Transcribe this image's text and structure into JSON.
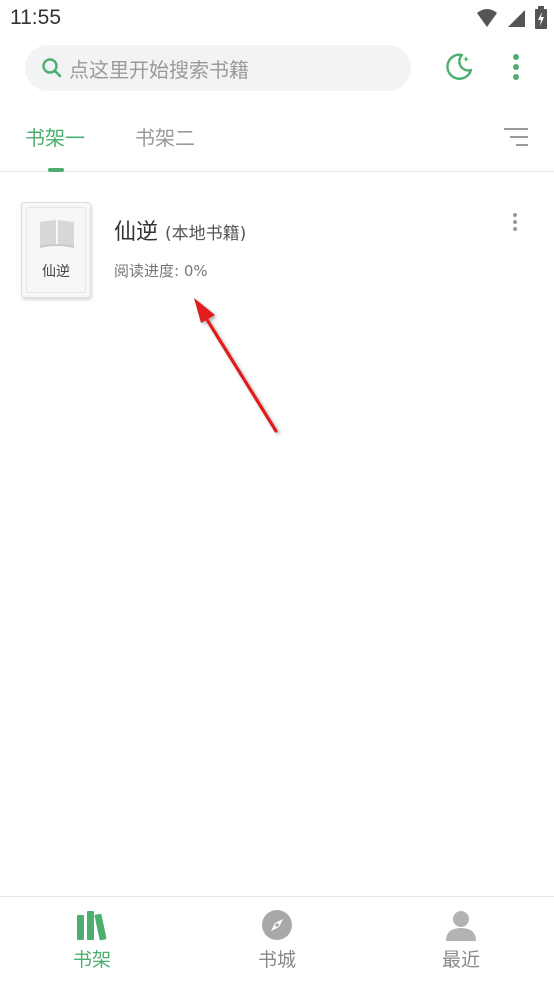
{
  "status_bar": {
    "time": "11:55"
  },
  "search": {
    "placeholder": "点这里开始搜索书籍"
  },
  "tabs": [
    {
      "label": "书架一",
      "active": true
    },
    {
      "label": "书架二",
      "active": false
    }
  ],
  "books": [
    {
      "cover_title": "仙逆",
      "title": "仙逆",
      "source": "(本地书籍)",
      "progress": "阅读进度: 0%"
    }
  ],
  "bottom_nav": [
    {
      "label": "书架",
      "icon": "bookshelf-icon",
      "active": true
    },
    {
      "label": "书城",
      "icon": "compass-icon",
      "active": false
    },
    {
      "label": "最近",
      "icon": "person-icon",
      "active": false
    }
  ],
  "colors": {
    "accent": "#4caf6e",
    "annotation_arrow": "#e01b1b"
  }
}
